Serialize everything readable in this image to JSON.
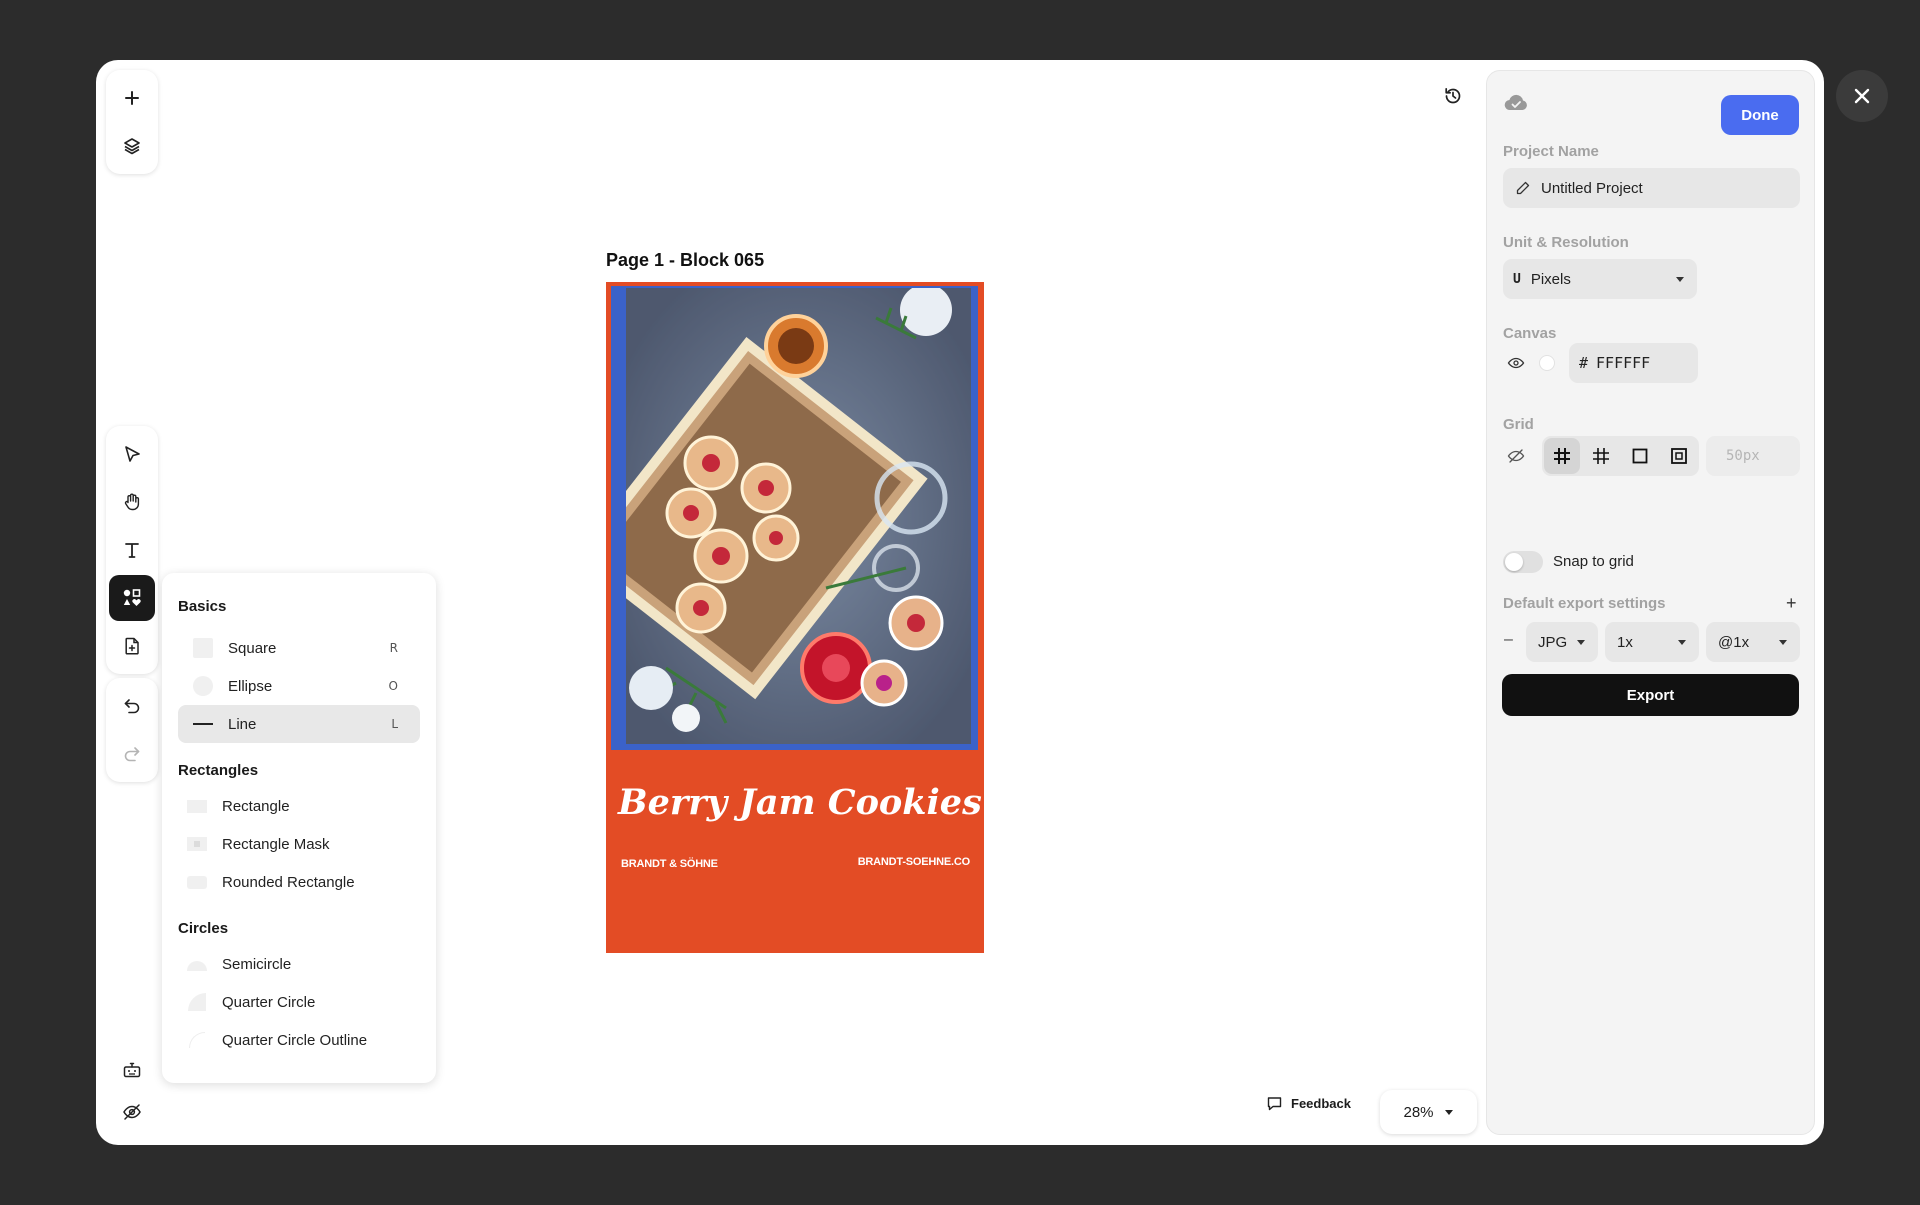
{
  "colors": {
    "accent": "#4a6cf0",
    "artboard_bg": "#e34c25",
    "photo_border": "#3b62c9"
  },
  "toolbar_top": [
    {
      "name": "add",
      "icon": "plus-icon"
    },
    {
      "name": "layers",
      "icon": "layers-icon"
    }
  ],
  "toolbar_tools": [
    {
      "icon": "pointer-icon"
    },
    {
      "icon": "hand-icon"
    },
    {
      "icon": "text-icon"
    },
    {
      "icon": "shapes-icon",
      "active": true
    },
    {
      "icon": "add-page-icon"
    }
  ],
  "toolbar_history": [
    {
      "icon": "undo-icon"
    },
    {
      "icon": "redo-icon"
    }
  ],
  "shapes_panel": {
    "sections": [
      {
        "title": "Basics",
        "items": [
          {
            "label": "Square",
            "key": "R"
          },
          {
            "label": "Ellipse",
            "key": "O"
          },
          {
            "label": "Line",
            "key": "L",
            "selected": true
          }
        ]
      },
      {
        "title": "Rectangles",
        "items": [
          {
            "label": "Rectangle"
          },
          {
            "label": "Rectangle Mask"
          },
          {
            "label": "Rounded Rectangle"
          }
        ]
      },
      {
        "title": "Circles",
        "items": [
          {
            "label": "Semicircle"
          },
          {
            "label": "Quarter Circle"
          },
          {
            "label": "Quarter Circle Outline"
          }
        ]
      }
    ]
  },
  "canvas": {
    "page_label": "Page 1 - Block 065",
    "title": "Berry Jam Cookies",
    "brand": "BRANDT & SÖHNE",
    "url": "BRANDT-SOEHNE.CO"
  },
  "footer": {
    "feedback": "Feedback",
    "zoom": "28%"
  },
  "panel": {
    "done": "Done",
    "project_name_label": "Project Name",
    "project_name": "Untitled Project",
    "unit_label": "Unit & Resolution",
    "unit_prefix": "U",
    "unit": "Pixels",
    "canvas_label": "Canvas",
    "canvas_hash": "#",
    "canvas_color": "FFFFFF",
    "grid_label": "Grid",
    "grid_size_placeholder": "50px",
    "snap_label": "Snap to grid",
    "export_label": "Default export settings",
    "export_plus": "+",
    "export_minus": "–",
    "format": "JPG",
    "scale": "1x",
    "density": "@1x",
    "export": "Export"
  }
}
